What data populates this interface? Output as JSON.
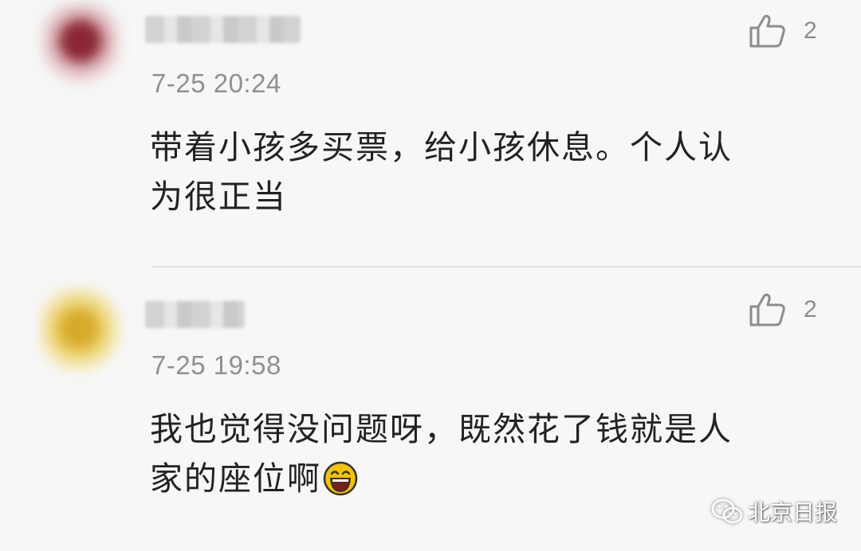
{
  "comments": [
    {
      "time": "7-25 20:24",
      "likes": "2",
      "text_lines": [
        "带着小孩多买票，给小孩休息。个人认",
        "为很正当"
      ],
      "avatar_color": "#8a2633"
    },
    {
      "time": "7-25 19:58",
      "likes": "2",
      "text_lines": [
        "我也觉得没问题呀，既然花了钱就是人",
        "家的座位啊"
      ],
      "avatar_color": "#d6aa2a",
      "emoji": "laughing-face-icon"
    }
  ],
  "watermark": {
    "label": "北京日报",
    "icon": "wechat-icon"
  },
  "colors": {
    "background": "#f7f7f7",
    "text": "#222222",
    "meta": "#909090",
    "divider": "#e3e3e3"
  }
}
